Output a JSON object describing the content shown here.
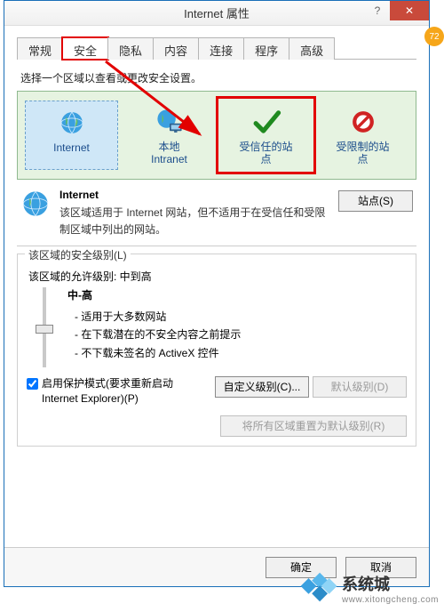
{
  "titlebar": {
    "title": "Internet 属性",
    "help": "?",
    "close": "✕"
  },
  "tabs": [
    "常规",
    "安全",
    "隐私",
    "内容",
    "连接",
    "程序",
    "高级"
  ],
  "activeTab": 1,
  "instruction": "选择一个区域以查看或更改安全设置。",
  "zones": [
    {
      "label": "Internet",
      "icon": "globe"
    },
    {
      "label": "本地\nIntranet",
      "icon": "globe-monitor"
    },
    {
      "label": "受信任的站\n点",
      "icon": "check"
    },
    {
      "label": "受限制的站\n点",
      "icon": "forbidden"
    }
  ],
  "desc": {
    "head": "Internet",
    "body": "该区域适用于 Internet 网站，但不适用于在受信任和受限制区域中列出的网站。",
    "sitesBtn": "站点(S)"
  },
  "group": {
    "legend": "该区域的安全级别(L)",
    "allow": "该区域的允许级别: 中到高",
    "levelName": "中-高",
    "bullets": [
      "- 适用于大多数网站",
      "- 在下载潜在的不安全内容之前提示",
      "- 不下载未签名的 ActiveX 控件"
    ],
    "checkbox": "启用保护模式(要求重新启动 Internet Explorer)(P)",
    "customBtn": "自定义级别(C)...",
    "defaultBtn": "默认级别(D)",
    "resetBtn": "将所有区域重置为默认级别(R)"
  },
  "bottom": {
    "ok": "确定",
    "cancel": "取消"
  },
  "badge": "72",
  "watermark": {
    "zh": "系统城",
    "en": "www.xitongcheng.com"
  },
  "colors": {
    "highlight": "#e20000",
    "zoneBg": "#e6f3e1",
    "accent": "#3aa0e0"
  }
}
